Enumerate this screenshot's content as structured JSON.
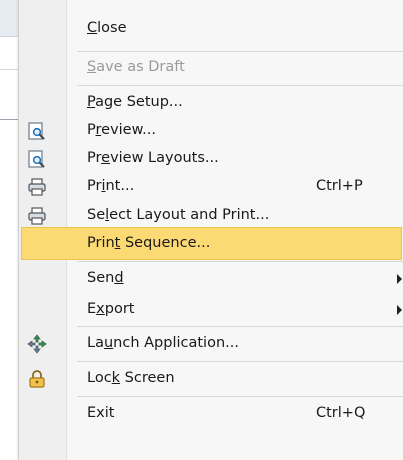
{
  "menu": {
    "items": [
      {
        "label": "Close",
        "accel": "C",
        "shortcut": "",
        "icon": "",
        "disabled": false
      },
      {
        "label": "Save as Draft",
        "accel": "S",
        "shortcut": "",
        "icon": "",
        "disabled": true
      },
      {
        "label": "Page Setup...",
        "accel": "P",
        "shortcut": "",
        "icon": "",
        "disabled": false
      },
      {
        "label": "Preview...",
        "accel": "r",
        "shortcut": "",
        "icon": "preview-icon",
        "disabled": false
      },
      {
        "label": "Preview Layouts...",
        "accel": "e",
        "shortcut": "",
        "icon": "preview-layouts-icon",
        "disabled": false
      },
      {
        "label": "Print...",
        "accel": "i",
        "shortcut": "Ctrl+P",
        "icon": "printer-icon",
        "disabled": false
      },
      {
        "label": "Select Layout and Print...",
        "accel": "l",
        "shortcut": "",
        "icon": "printer-icon",
        "disabled": false
      },
      {
        "label": "Print Sequence...",
        "accel": "t",
        "shortcut": "",
        "icon": "",
        "disabled": false,
        "highlighted": true
      },
      {
        "label": "Send",
        "accel": "d",
        "shortcut": "",
        "icon": "",
        "disabled": false,
        "submenu": true
      },
      {
        "label": "Export",
        "accel": "x",
        "shortcut": "",
        "icon": "",
        "disabled": false,
        "submenu": true
      },
      {
        "label": "Launch Application...",
        "accel": "u",
        "shortcut": "",
        "icon": "launch-application-icon",
        "disabled": false
      },
      {
        "label": "Lock Screen",
        "accel": "k",
        "shortcut": "",
        "icon": "lock-icon",
        "disabled": false
      },
      {
        "label": "Exit",
        "accel": "",
        "shortcut": "Ctrl+Q",
        "icon": "",
        "disabled": false
      }
    ]
  },
  "colors": {
    "highlight": "#fbd973",
    "disabled_text": "#9a9a9a",
    "menu_background": "#f7f7f7"
  }
}
